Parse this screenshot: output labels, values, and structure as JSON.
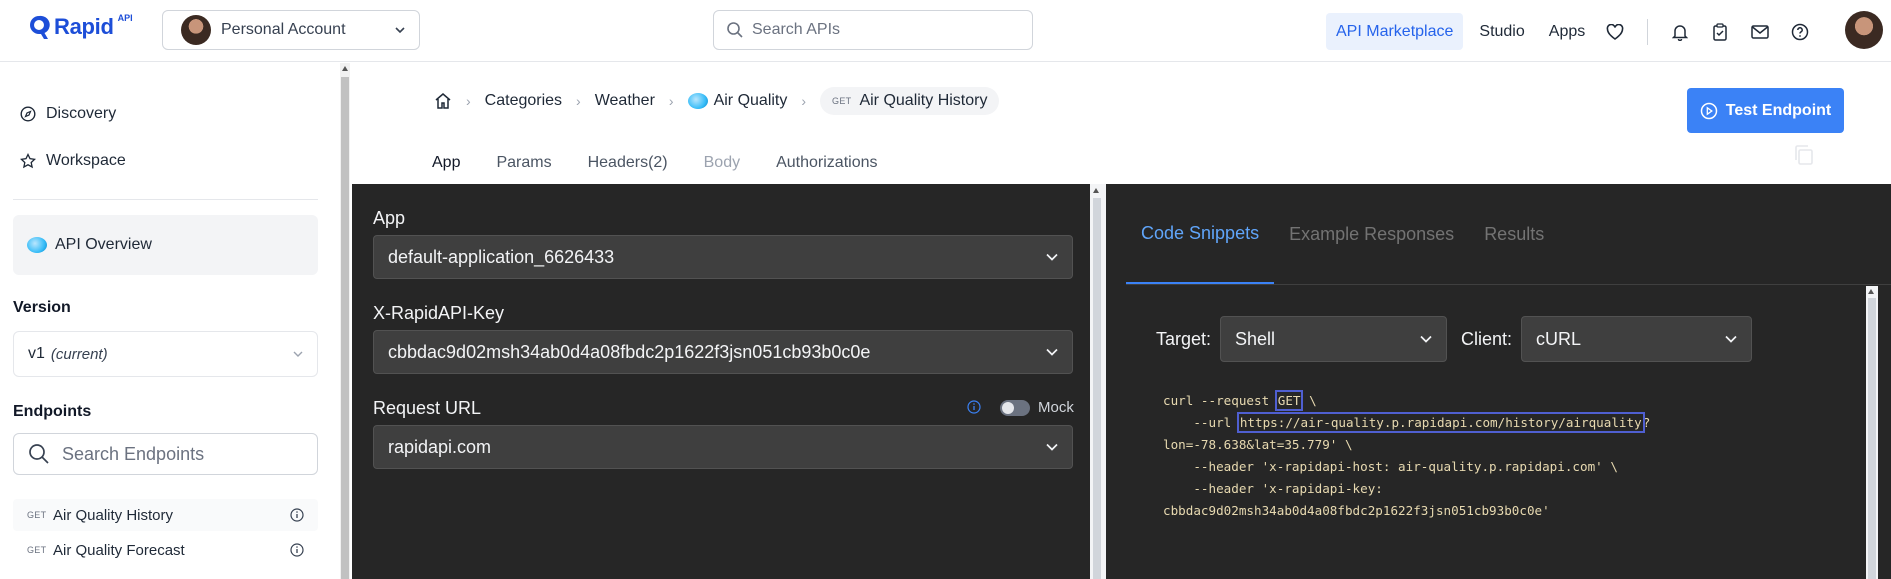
{
  "topbar": {
    "logo_text": "Rapid",
    "logo_sup": "API",
    "account_label": "Personal Account",
    "search_placeholder": "Search APIs",
    "nav": {
      "marketplace": "API Marketplace",
      "studio": "Studio",
      "apps": "Apps"
    }
  },
  "sidebar": {
    "discovery": "Discovery",
    "workspace": "Workspace",
    "api_overview": "API Overview",
    "version_title": "Version",
    "version_value": "v1",
    "version_note": "(current)",
    "endpoints_title": "Endpoints",
    "endpoint_search_placeholder": "Search Endpoints",
    "endpoints": [
      {
        "method": "GET",
        "name": "Air Quality History"
      },
      {
        "method": "GET",
        "name": "Air Quality Forecast"
      }
    ]
  },
  "breadcrumb": {
    "categories": "Categories",
    "weather": "Weather",
    "api": "Air Quality",
    "endpoint_method": "GET",
    "endpoint": "Air Quality History"
  },
  "test_button": "Test Endpoint",
  "tabs": [
    "App",
    "Params",
    "Headers(2)",
    "Body",
    "Authorizations"
  ],
  "request": {
    "app_label": "App",
    "app_value": "default-application_6626433",
    "key_label": "X-RapidAPI-Key",
    "key_value": "cbbdac9d02msh34ab0d4a08fbdc2p1622f3jsn051cb93b0c0e",
    "url_label": "Request URL",
    "mock_label": "Mock",
    "url_value": "rapidapi.com"
  },
  "response_tabs": [
    "Code Snippets",
    "Example Responses",
    "Results"
  ],
  "snippet": {
    "target_label": "Target:",
    "target_value": "Shell",
    "client_label": "Client:",
    "client_value": "cURL",
    "line1_pre": "curl --request ",
    "line1_method": "GET",
    "line1_post": " \\",
    "line2_pre": "    --url ",
    "line2_url": "https://air-quality.p.rapidapi.com/history/airquality",
    "line2_post": "?",
    "line3": "lon=-78.638&lat=35.779' \\",
    "line4": "    --header 'x-rapidapi-host: air-quality.p.rapidapi.com' \\",
    "line5": "    --header 'x-rapidapi-key:",
    "line6": "cbbdac9d02msh34ab0d4a08fbdc2p1622f3jsn051cb93b0c0e'"
  },
  "colors": {
    "accent": "#3b82f6",
    "panel_bg": "#262626",
    "code_text": "#e7d9b0",
    "highlight": "#4f5fd1"
  }
}
